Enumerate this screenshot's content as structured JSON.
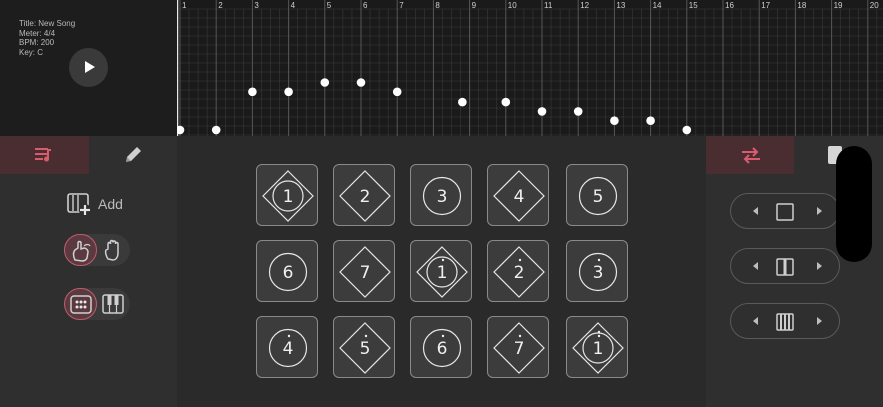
{
  "song": {
    "title_line": "Title: New Song",
    "meter_line": "Meter: 4/4",
    "bpm_line": "BPM: 200",
    "key_line": "Key: C"
  },
  "play_icon": "play-icon",
  "timeline": {
    "measures": [
      "1",
      "2",
      "3",
      "4",
      "5",
      "6",
      "7",
      "8",
      "9",
      "10",
      "11",
      "12",
      "13",
      "14",
      "15",
      "16",
      "17",
      "18",
      "19",
      "20"
    ],
    "notes": [
      {
        "beat": 1,
        "row": 7
      },
      {
        "beat": 2,
        "row": 7
      },
      {
        "beat": 3,
        "row": 3
      },
      {
        "beat": 4,
        "row": 3
      },
      {
        "beat": 5,
        "row": 2
      },
      {
        "beat": 6,
        "row": 2
      },
      {
        "beat": 7,
        "row": 3
      },
      {
        "beat": 8.8,
        "row": 4
      },
      {
        "beat": 10,
        "row": 4
      },
      {
        "beat": 11,
        "row": 5
      },
      {
        "beat": 12,
        "row": 5
      },
      {
        "beat": 13,
        "row": 6
      },
      {
        "beat": 14,
        "row": 6
      },
      {
        "beat": 15,
        "row": 7
      }
    ]
  },
  "left_panel": {
    "tabs": [
      {
        "icon": "playlist-icon",
        "active": true
      },
      {
        "icon": "pencil-icon",
        "active": false
      }
    ],
    "add_label": "Add",
    "gesture_toggle": {
      "left_icon": "hand-draw-icon",
      "right_icon": "hand-icon",
      "selected": "left"
    },
    "input_toggle": {
      "left_icon": "grid-dots-icon",
      "right_icon": "piano-icon",
      "selected": "left"
    }
  },
  "pads": [
    {
      "label": "1",
      "dot": "",
      "shape": "both"
    },
    {
      "label": "2",
      "dot": "",
      "shape": "diamond"
    },
    {
      "label": "3",
      "dot": "",
      "shape": "circle"
    },
    {
      "label": "4",
      "dot": "",
      "shape": "diamond"
    },
    {
      "label": "5",
      "dot": "",
      "shape": "circle"
    },
    {
      "label": "6",
      "dot": "",
      "shape": "circle"
    },
    {
      "label": "7",
      "dot": "",
      "shape": "diamond"
    },
    {
      "label": "1",
      "dot": "above",
      "shape": "both"
    },
    {
      "label": "2",
      "dot": "above",
      "shape": "diamond"
    },
    {
      "label": "3",
      "dot": "above",
      "shape": "circle"
    },
    {
      "label": "4",
      "dot": "above",
      "shape": "circle"
    },
    {
      "label": "5",
      "dot": "above",
      "shape": "diamond"
    },
    {
      "label": "6",
      "dot": "above",
      "shape": "circle"
    },
    {
      "label": "7",
      "dot": "above",
      "shape": "diamond"
    },
    {
      "label": "1",
      "dot": "above2",
      "shape": "both"
    }
  ],
  "right_panel": {
    "tabs": [
      {
        "icon": "swap-arrows-icon",
        "active": true
      },
      {
        "icon": "page-icon",
        "active": false
      }
    ],
    "steppers": [
      {
        "icon": "single-bar-icon"
      },
      {
        "icon": "split-bar-icon"
      },
      {
        "icon": "multi-bar-icon"
      }
    ]
  },
  "colors": {
    "accent": "#c25c6b",
    "accent_bg": "#4a2d31",
    "panel": "#2f2f2f",
    "grid_bg": "#1a1a1a"
  }
}
